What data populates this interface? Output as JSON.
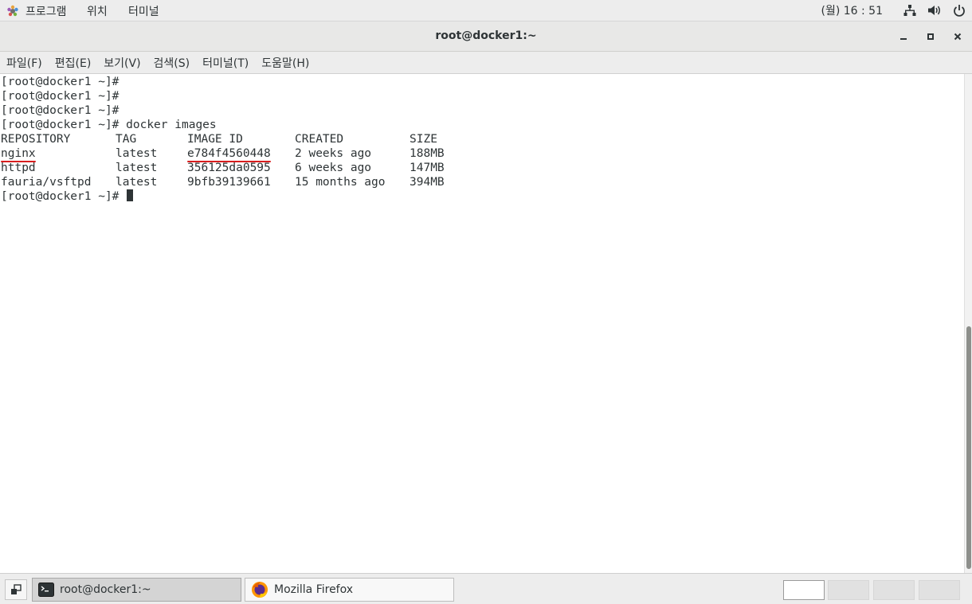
{
  "top_panel": {
    "menus": [
      "프로그램",
      "위치",
      "터미널"
    ],
    "clock": "(월) 16 : 51",
    "icons": [
      "applications-icon",
      "network-icon",
      "volume-icon",
      "power-icon"
    ]
  },
  "window": {
    "title": "root@docker1:~",
    "controls": [
      "minimize-icon",
      "maximize-icon",
      "close-icon"
    ]
  },
  "menubar": {
    "items": [
      "파일(F)",
      "편집(E)",
      "보기(V)",
      "검색(S)",
      "터미널(T)",
      "도움말(H)"
    ]
  },
  "terminal": {
    "prompt": "[root@docker1 ~]#",
    "empty_prompts": 3,
    "command": "docker images",
    "table": {
      "headers": [
        "REPOSITORY",
        "TAG",
        "IMAGE ID",
        "CREATED",
        "SIZE"
      ],
      "rows": [
        [
          "nginx",
          "latest",
          "e784f4560448",
          "2 weeks ago",
          "188MB"
        ],
        [
          "httpd",
          "latest",
          "356125da0595",
          "6 weeks ago",
          "147MB"
        ],
        [
          "fauria/vsftpd",
          "latest",
          "9bfb39139661",
          "15 months ago",
          "394MB"
        ]
      ],
      "underlined_red": [
        "nginx",
        "e784f4560448"
      ]
    },
    "annotation_color": "#d81e1e"
  },
  "taskbar": {
    "tasks": [
      {
        "label": "root@docker1:~",
        "icon": "terminal-icon",
        "active": true
      },
      {
        "label": "Mozilla Firefox",
        "icon": "firefox-icon",
        "active": false
      }
    ],
    "workspaces": 4,
    "active_workspace": 1
  }
}
